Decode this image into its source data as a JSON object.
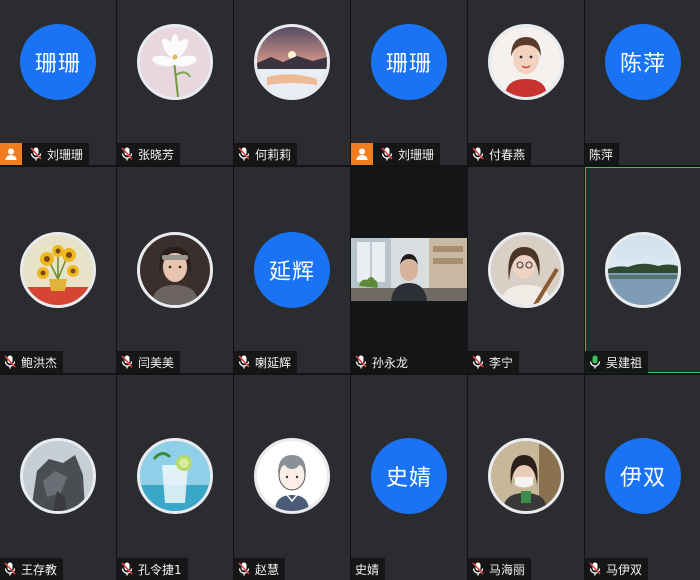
{
  "participants": [
    {
      "name": "刘珊珊",
      "avatar": {
        "kind": "text",
        "text": "珊珊"
      },
      "host": true,
      "mic": "muted"
    },
    {
      "name": "张晓芳",
      "avatar": {
        "kind": "image",
        "icon": "lily-flower-photo"
      },
      "host": false,
      "mic": "muted"
    },
    {
      "name": "何莉莉",
      "avatar": {
        "kind": "image",
        "icon": "sunset-snow-photo"
      },
      "host": false,
      "mic": "muted"
    },
    {
      "name": "刘珊珊",
      "avatar": {
        "kind": "text",
        "text": "珊珊"
      },
      "host": true,
      "mic": "muted"
    },
    {
      "name": "付春燕",
      "avatar": {
        "kind": "image",
        "icon": "woman-portrait-photo"
      },
      "host": false,
      "mic": "muted"
    },
    {
      "name": "陈萍",
      "avatar": {
        "kind": "text",
        "text": "陈萍"
      },
      "host": false,
      "mic": "none"
    },
    {
      "name": "鲍洪杰",
      "avatar": {
        "kind": "image",
        "icon": "sunflowers-painting"
      },
      "host": false,
      "mic": "muted"
    },
    {
      "name": "闫美美",
      "avatar": {
        "kind": "image",
        "icon": "woman-headband-photo"
      },
      "host": false,
      "mic": "muted"
    },
    {
      "name": "喇延辉",
      "avatar": {
        "kind": "text",
        "text": "延辉"
      },
      "host": false,
      "mic": "muted"
    },
    {
      "name": "孙永龙",
      "avatar": {
        "kind": "video",
        "icon": "camera-video-feed"
      },
      "host": false,
      "mic": "muted"
    },
    {
      "name": "李宁",
      "avatar": {
        "kind": "image",
        "icon": "girl-guitar-photo"
      },
      "host": false,
      "mic": "muted"
    },
    {
      "name": "吴建祖",
      "avatar": {
        "kind": "image",
        "icon": "lake-landscape-photo"
      },
      "host": false,
      "mic": "active",
      "speaking": true
    },
    {
      "name": "王存教",
      "avatar": {
        "kind": "image",
        "icon": "rock-formation-photo"
      },
      "host": false,
      "mic": "muted"
    },
    {
      "name": "孔令捷1",
      "avatar": {
        "kind": "image",
        "icon": "iced-drink-photo"
      },
      "host": false,
      "mic": "muted"
    },
    {
      "name": "赵慧",
      "avatar": {
        "kind": "image",
        "icon": "cartoon-boy-drawing"
      },
      "host": false,
      "mic": "muted"
    },
    {
      "name": "史婧",
      "avatar": {
        "kind": "text",
        "text": "史婧"
      },
      "host": false,
      "mic": "none"
    },
    {
      "name": "马海丽",
      "avatar": {
        "kind": "image",
        "icon": "woman-masked-photo"
      },
      "host": false,
      "mic": "muted"
    },
    {
      "name": "马伊双",
      "avatar": {
        "kind": "text",
        "text": "伊双"
      },
      "host": false,
      "mic": "muted"
    }
  ],
  "colors": {
    "tile_bg": "#2b2c2f",
    "text_avatar_bg": "#1a73f5",
    "host_badge": "#f07d1f",
    "mic_muted": "#e0473e",
    "mic_active": "#3fbf5a",
    "speaking_border": "#3fbf5a"
  }
}
